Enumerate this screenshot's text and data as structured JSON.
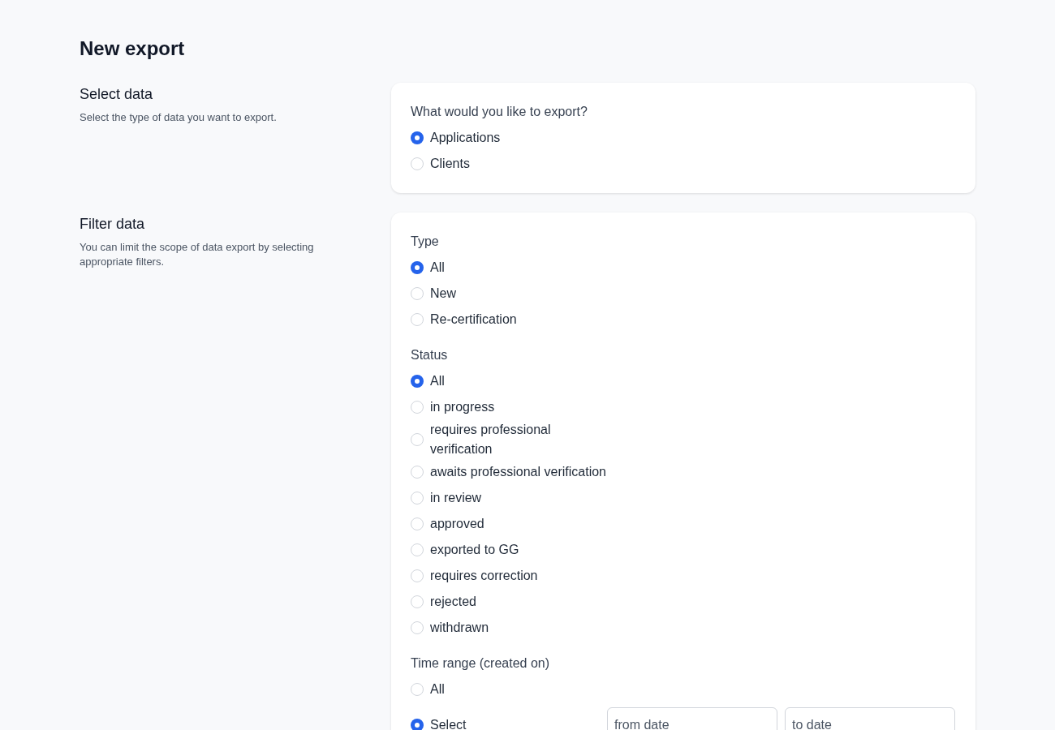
{
  "title": "New export",
  "sections": [
    {
      "heading": "Select data",
      "description": "Select the type of data you want to export.",
      "groups": [
        {
          "label": "What would you like to export?",
          "options": [
            {
              "label": "Applications",
              "selected": true
            },
            {
              "label": "Clients",
              "selected": false
            }
          ]
        }
      ]
    },
    {
      "heading": "Filter data",
      "description": "You can limit the scope of data export by selecting appropriate filters.",
      "groups": [
        {
          "label": "Type",
          "options": [
            {
              "label": "All",
              "selected": true
            },
            {
              "label": "New",
              "selected": false
            },
            {
              "label": "Re-certification",
              "selected": false
            }
          ]
        },
        {
          "label": "Status",
          "options": [
            {
              "label": "All",
              "selected": true
            },
            {
              "label": "in progress",
              "selected": false
            },
            {
              "label": "requires professional verification",
              "selected": false
            },
            {
              "label": "awaits professional verification",
              "selected": false
            },
            {
              "label": "in review",
              "selected": false
            },
            {
              "label": "approved",
              "selected": false
            },
            {
              "label": "exported to GG",
              "selected": false
            },
            {
              "label": "requires correction",
              "selected": false
            },
            {
              "label": "rejected",
              "selected": false
            },
            {
              "label": "withdrawn",
              "selected": false
            }
          ]
        },
        {
          "label": "Time range (created on)",
          "options": [
            {
              "label": "All",
              "selected": false
            },
            {
              "label": "Select",
              "selected": true,
              "fields": [
                {
                  "placeholder": "from date"
                },
                {
                  "placeholder": "to date"
                }
              ]
            }
          ]
        }
      ]
    }
  ]
}
